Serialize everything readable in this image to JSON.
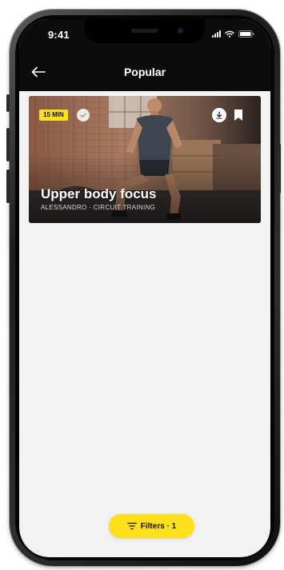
{
  "status_bar": {
    "time": "9:41",
    "signal_icon": "signal-bars-icon",
    "wifi_icon": "wifi-icon",
    "battery_icon": "battery-icon"
  },
  "header": {
    "back_icon": "arrow-left-icon",
    "title": "Popular"
  },
  "workouts": [
    {
      "duration_badge": "15 MIN",
      "completed_icon": "check-circle-icon",
      "download_icon": "download-icon",
      "bookmark_icon": "bookmark-icon",
      "title": "Upper body focus",
      "subtitle": "ALESSANDRO · CIRCUIT TRAINING"
    }
  ],
  "filters": {
    "icon": "filter-lines-icon",
    "label": "Filters · 1"
  },
  "colors": {
    "accent": "#ffe01b",
    "bar_background": "#0c0c0c",
    "screen_background": "#f2f2f2"
  }
}
